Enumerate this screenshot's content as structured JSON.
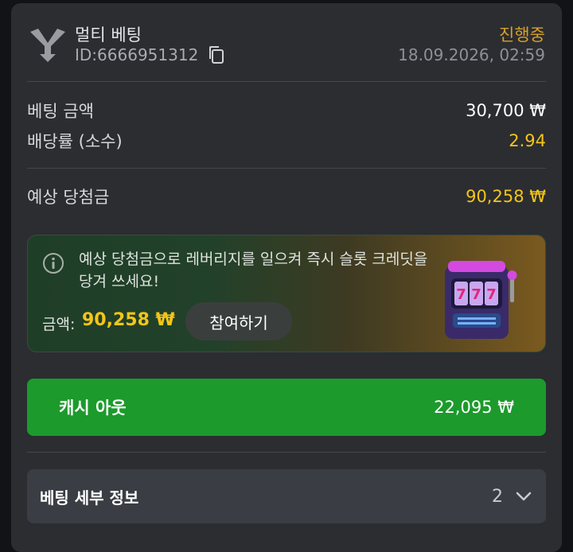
{
  "header": {
    "bet_type": "멀티 베팅",
    "id_label": "ID: ",
    "id_value": "6666951312",
    "status": "진행중",
    "datetime": "18.09.2026, 02:59"
  },
  "summary": {
    "stake_label": "베팅 금액",
    "stake_value": "30,700 ₩",
    "odds_label": "배당률 (소수)",
    "odds_value": "2.94",
    "potential_label": "예상 당첨금",
    "potential_value": "90,258 ₩"
  },
  "promo": {
    "message": "예상 당첨금으로 레버리지를 일으켜 즉시 슬롯 크레딧을 당겨 쓰세요!",
    "amount_label": "금액:",
    "amount_value": "90,258 ₩",
    "join_label": "참여하기"
  },
  "cashout": {
    "label": "캐시 아웃",
    "value": "22,095 ₩"
  },
  "details": {
    "label": "베팅 세부 정보",
    "count": "2"
  },
  "colors": {
    "card_bg": "#2b2d31",
    "accent_green": "#1c9a2c",
    "yellow": "#f5c518",
    "status_orange": "#d6a12a"
  },
  "icons": [
    "multi-bet-logo-icon",
    "copy-icon",
    "info-icon",
    "slot-machine-icon",
    "chevron-down-icon"
  ]
}
